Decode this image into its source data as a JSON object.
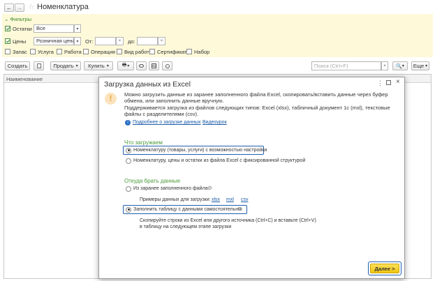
{
  "title_bar": {
    "title": "Номенклатура"
  },
  "filters": {
    "header": "Фильтры",
    "ostatki_label": "Остатки",
    "ostatki_value": "Все",
    "ceny_label": "Цены",
    "ceny_value": "Розничная цена",
    "from_label": "От:",
    "to_label": "до:",
    "types": [
      "Запас",
      "Услуга",
      "Работа",
      "Операция",
      "Вид работ",
      "Сертификат",
      "Набор"
    ]
  },
  "toolbar": {
    "create": "Создать",
    "sell": "Продать",
    "buy": "Купить",
    "search_placeholder": "Поиск (Ctrl+F)",
    "more": "Еще"
  },
  "table": {
    "column_name": "Наименование"
  },
  "dialog": {
    "title": "Загрузка данных из Excel",
    "info_lines": [
      "Можно загрузить данные из заранее заполненного файла Excel, скопировать/вставить данные через буфер",
      "обмена, или заполнить данные вручную.",
      "Поддерживается загрузка из файлов следующих типов: Excel (xlsx), табличный документ 1с (mxl), текстовые",
      "файлы с разделителями (csv)."
    ],
    "link_more": "Подробнее о загрузке данных",
    "link_video": "Видеоурок",
    "section_what": "Что загружаем",
    "what_option1": "Номенклатуру (товары, услуги) с возможностью настройки",
    "what_option2": "Номенклатуру, цены и остатки из файла Excel с фиксированной структурой",
    "section_where": "Откуда брать данные",
    "where_option1": "Из заранее заполненного файла",
    "examples_label": "Примеры данных для загрузки:",
    "examples": [
      "xlsx",
      "mxl",
      "csv"
    ],
    "where_option2": "Заполнить таблицу с данными самостоятельно",
    "hint_lines": [
      "Скопируйте строки из Excel или другого источника (Ctrl+C) и вставьте (Ctrl+V)",
      "в таблицу на следующем этапе загрузки"
    ],
    "next_button": "Далее >",
    "colors": {
      "section_green": "#4a9a3a",
      "highlight_blue": "#1f5fb0",
      "next_yellow": "#f5d31a"
    }
  }
}
